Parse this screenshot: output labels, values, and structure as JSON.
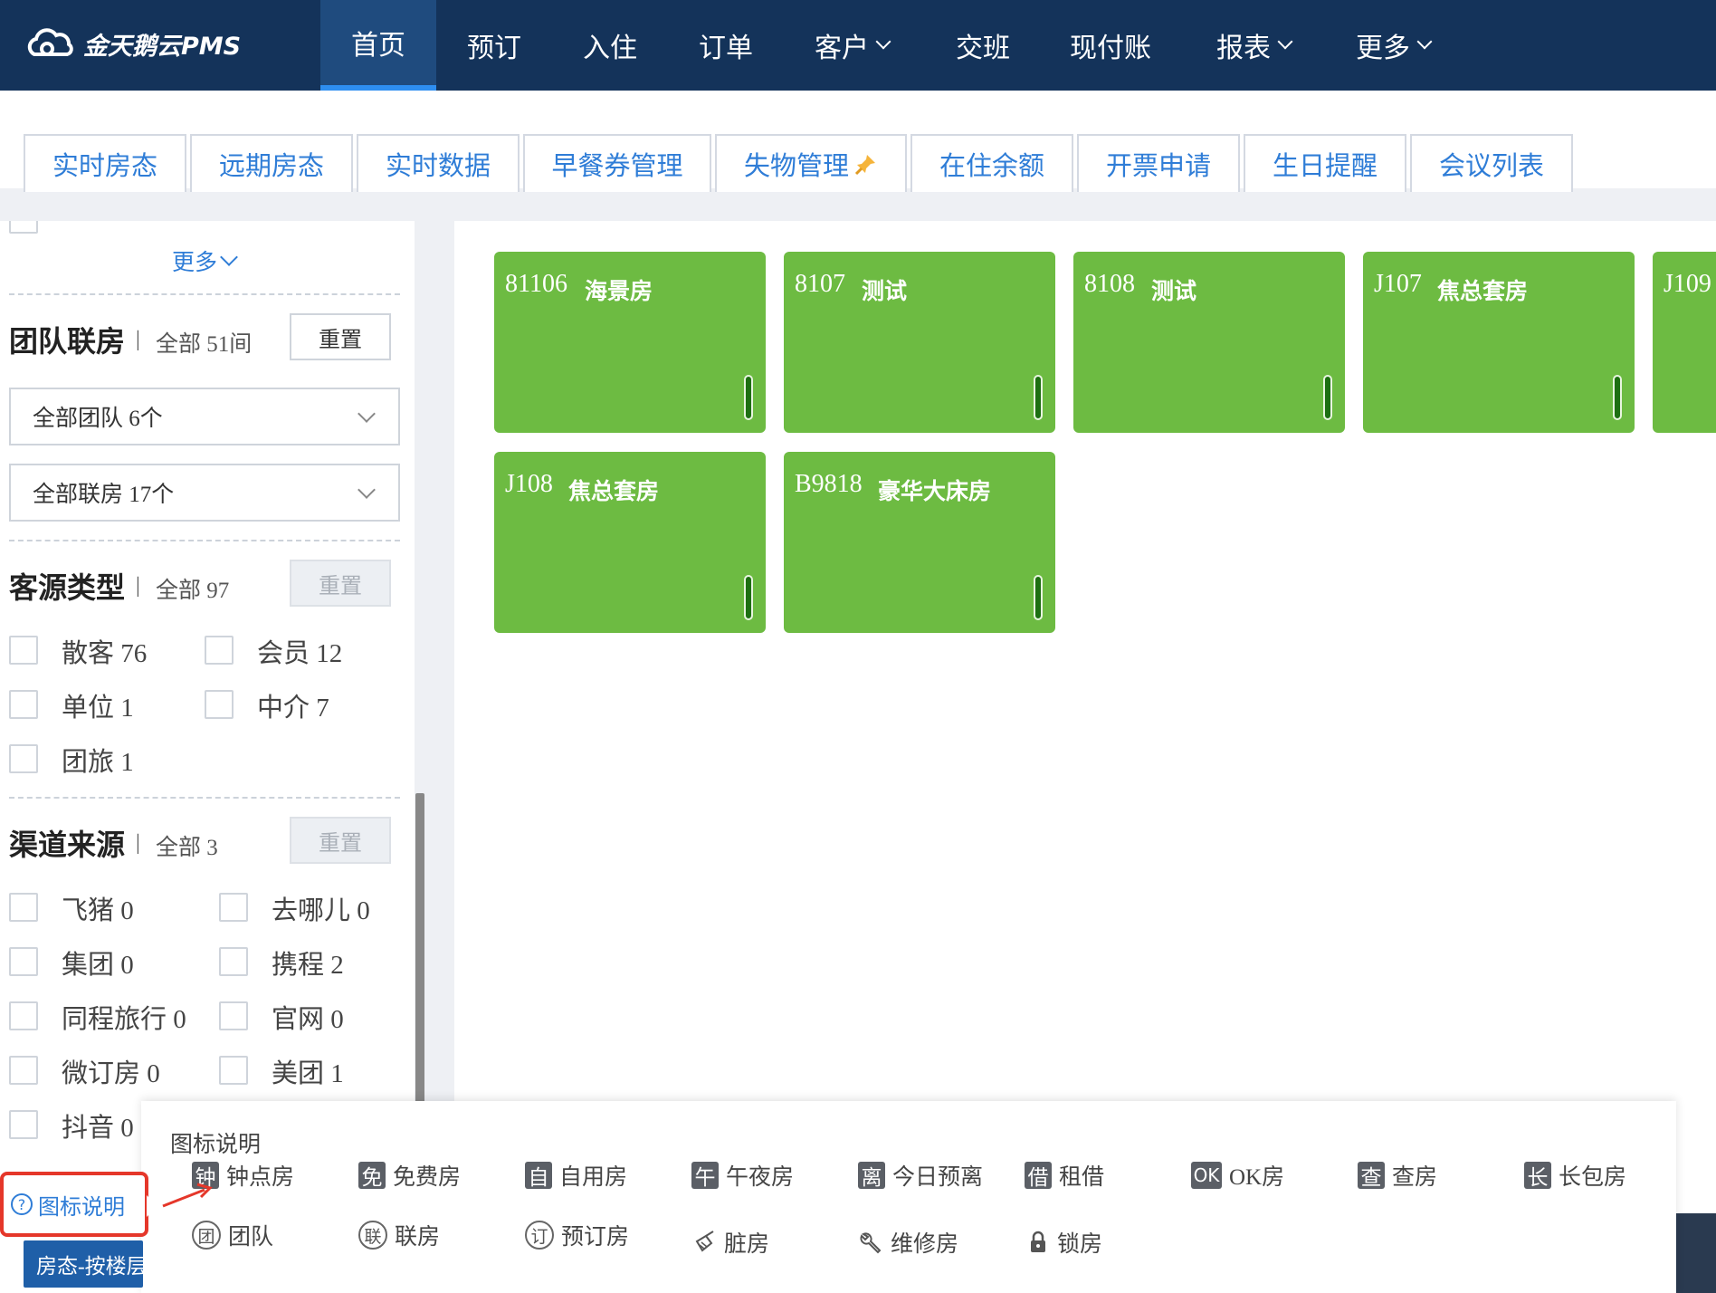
{
  "app": {
    "logo_text": "金天鹅云PMS"
  },
  "nav": {
    "items": [
      {
        "label": "首页",
        "active": true,
        "dropdown": false
      },
      {
        "label": "预订",
        "active": false,
        "dropdown": false
      },
      {
        "label": "入住",
        "active": false,
        "dropdown": false
      },
      {
        "label": "订单",
        "active": false,
        "dropdown": false
      },
      {
        "label": "客户",
        "active": false,
        "dropdown": true
      },
      {
        "label": "交班",
        "active": false,
        "dropdown": false
      },
      {
        "label": "现付账",
        "active": false,
        "dropdown": false
      },
      {
        "label": "报表",
        "active": false,
        "dropdown": true
      },
      {
        "label": "更多",
        "active": false,
        "dropdown": true
      }
    ]
  },
  "subtabs": [
    {
      "label": "实时房态"
    },
    {
      "label": "远期房态"
    },
    {
      "label": "实时数据"
    },
    {
      "label": "早餐券管理"
    },
    {
      "label": "失物管理",
      "icon": "pin-icon"
    },
    {
      "label": "在住余额"
    },
    {
      "label": "开票申请"
    },
    {
      "label": "生日提醒"
    },
    {
      "label": "会议列表"
    }
  ],
  "sidebar": {
    "more_label": "更多",
    "team": {
      "title": "团队联房",
      "separator": "|",
      "count": "全部 51间",
      "reset": "重置",
      "select_team": "全部团队 6个",
      "select_linked": "全部联房 17个"
    },
    "source": {
      "title": "客源类型",
      "separator": "|",
      "count": "全部 97",
      "reset": "重置",
      "options": [
        "散客 76",
        "会员 12",
        "单位 1",
        "中介 7",
        "团旅 1"
      ]
    },
    "channel": {
      "title": "渠道来源",
      "separator": "|",
      "count": "全部 3",
      "reset": "重置",
      "options": [
        "飞猪 0",
        "去哪儿 0",
        "集团 0",
        "携程 2",
        "同程旅行 0",
        "官网 0",
        "微订房 0",
        "美团 1",
        "抖音 0"
      ]
    }
  },
  "rooms": [
    {
      "number": "81106",
      "type": "海景房"
    },
    {
      "number": "8107",
      "type": "测试"
    },
    {
      "number": "8108",
      "type": "测试"
    },
    {
      "number": "J107",
      "type": "焦总套房"
    },
    {
      "number": "J109",
      "type": ""
    },
    {
      "number": "J108",
      "type": "焦总套房"
    },
    {
      "number": "B9818",
      "type": "豪华大床房"
    }
  ],
  "legend": {
    "title": "图标说明",
    "row1": [
      {
        "glyph": "钟",
        "label": "钟点房"
      },
      {
        "glyph": "免",
        "label": "免费房"
      },
      {
        "glyph": "自",
        "label": "自用房"
      },
      {
        "glyph": "午",
        "label": "午夜房"
      },
      {
        "glyph": "离",
        "label": "今日预离"
      },
      {
        "glyph": "借",
        "label": "租借"
      },
      {
        "glyph": "OK",
        "label": "OK房"
      },
      {
        "glyph": "查",
        "label": "查房"
      },
      {
        "glyph": "长",
        "label": "长包房"
      }
    ],
    "row2": [
      {
        "glyph": "团",
        "label": "团队"
      },
      {
        "glyph": "联",
        "label": "联房"
      },
      {
        "glyph": "订",
        "label": "预订房"
      },
      {
        "glyph": "broom-icon",
        "label": "脏房"
      },
      {
        "glyph": "wrench-icon",
        "label": "维修房"
      },
      {
        "glyph": "lock-icon",
        "label": "锁房"
      }
    ]
  },
  "footer": {
    "legend_toggle": "图标说明",
    "legend_toggle_icon": "?",
    "mode_button": "房态-按楼层"
  },
  "colors": {
    "nav_bg": "#14335a",
    "room_vacant": "#6dbb42",
    "accent": "#2f7dd7",
    "highlight": "#e5372a"
  }
}
